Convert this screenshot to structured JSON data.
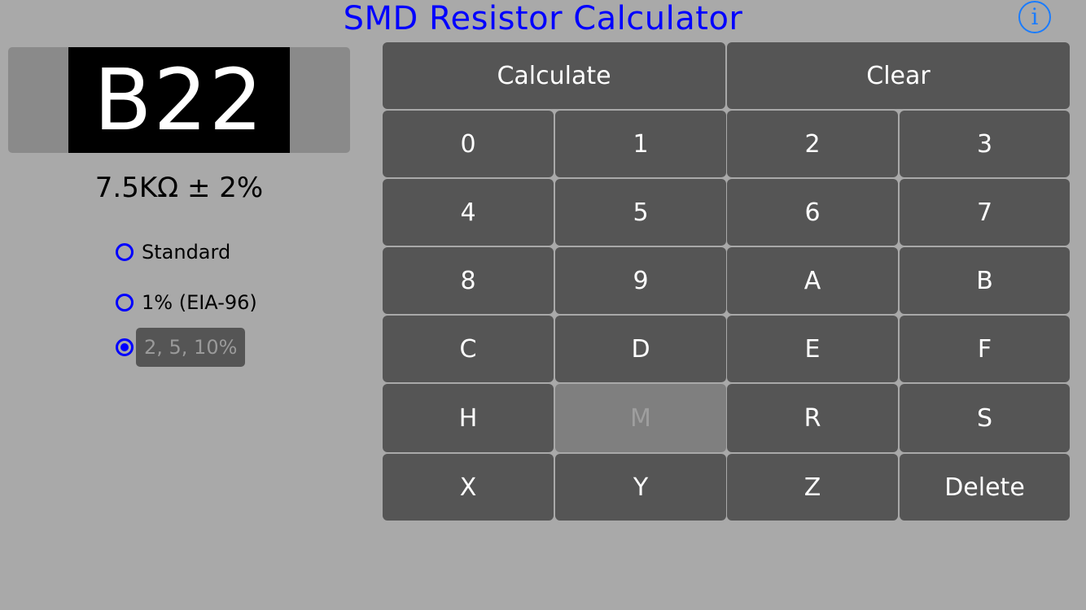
{
  "header": {
    "title": "SMD Resistor Calculator",
    "info_icon": "i"
  },
  "chip": {
    "code": "B22"
  },
  "result": {
    "text": "7.5KΩ ± 2%"
  },
  "modes": [
    {
      "label": "Standard",
      "selected": false
    },
    {
      "label": "1% (EIA-96)",
      "selected": false
    },
    {
      "label": "2, 5, 10%",
      "selected": true
    }
  ],
  "keypad": {
    "calculate": "Calculate",
    "clear": "Clear",
    "keys": [
      [
        "0",
        "1",
        "2",
        "3"
      ],
      [
        "4",
        "5",
        "6",
        "7"
      ],
      [
        "8",
        "9",
        "A",
        "B"
      ],
      [
        "C",
        "D",
        "E",
        "F"
      ],
      [
        "H",
        "M",
        "R",
        "S"
      ],
      [
        "X",
        "Y",
        "Z",
        "Delete"
      ]
    ],
    "disabled_keys": [
      "M"
    ]
  },
  "colors": {
    "title": "#0000ff",
    "info": "#1a7cff",
    "button": "#555555",
    "background": "#a9a9a9"
  }
}
